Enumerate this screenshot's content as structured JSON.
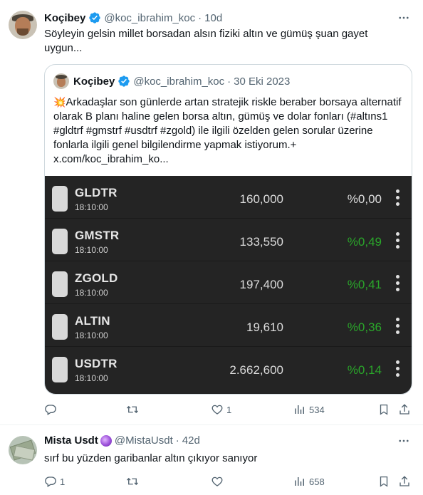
{
  "tweet1": {
    "name": "Koçibey",
    "handle": "@koc_ibrahim_koc",
    "separator": "·",
    "time": "10d",
    "text": "Söyleyin gelsin millet borsadan alsın fiziki altın ve gümüş şuan gayet uygun...",
    "quote": {
      "name": "Koçibey",
      "handle": "@koc_ibrahim_koc",
      "separator": "·",
      "date": "30 Eki 2023",
      "text": "Arkadaşlar son günlerde artan stratejik riskle beraber borsaya alternatif olarak B planı haline gelen  borsa altın, gümüş ve dolar fonları (#altıns1 #gldtrf #gmstrf #usdtrf #zgold)  ile ilgili özelden gelen sorular üzerine fonlarla ilgili genel bilgilendirme yapmak istiyorum.+ x.com/koc_ibrahim_ko...",
      "icon": "collision-emoji",
      "rows": [
        {
          "symbol": "GLDTR",
          "time": "18:10:00",
          "price": "160,000",
          "change": "%0,00",
          "trend": "flat"
        },
        {
          "symbol": "GMSTR",
          "time": "18:10:00",
          "price": "133,550",
          "change": "%0,49",
          "trend": "up"
        },
        {
          "symbol": "ZGOLD",
          "time": "18:10:00",
          "price": "197,400",
          "change": "%0,41",
          "trend": "up"
        },
        {
          "symbol": "ALTIN",
          "time": "18:10:00",
          "price": "19,610",
          "change": "%0,36",
          "trend": "up"
        },
        {
          "symbol": "USDTR",
          "time": "18:10:00",
          "price": "2.662,600",
          "change": "%0,14",
          "trend": "up"
        }
      ]
    },
    "actions": {
      "reply": "",
      "retweet": "",
      "like": "1",
      "views": "534"
    }
  },
  "tweet2": {
    "name": "Mista Usdt",
    "handle": "@MistaUsdt",
    "separator": "·",
    "time": "42d",
    "text": "sırf bu yüzden garibanlar altın çıkıyor sanıyor",
    "actions": {
      "reply": "1",
      "retweet": "",
      "like": "",
      "views": "658"
    }
  },
  "colors": {
    "verified": "#1d9bf0",
    "up": "#2aa52a",
    "ticker_bg": "#242424",
    "muted": "#536471"
  }
}
